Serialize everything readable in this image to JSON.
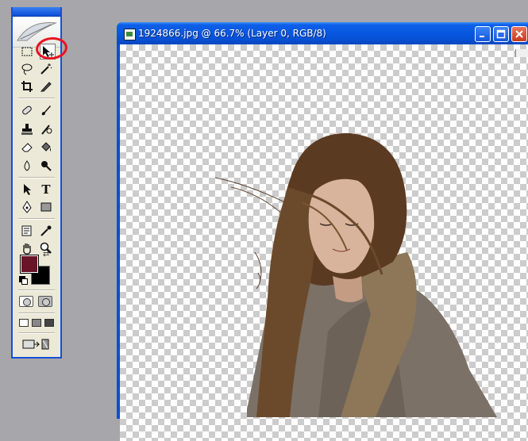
{
  "document": {
    "title": "1924866.jpg @ 66.7% (Layer 0, RGB/8)",
    "buttons": {
      "minimize": "_",
      "maximize": "□",
      "close": "✕"
    }
  },
  "toolbox": {
    "foreground_color": "#6a1428",
    "background_color": "#000000",
    "highlighted_tool": "move-tool",
    "highlight_color": "#e8141f",
    "type_tool_glyph": "T",
    "swap_glyph": "⇄"
  },
  "colors": {
    "desktop": "#a7a6aa",
    "xp_blue": "#0a4fd6",
    "checker": "#cccccc"
  }
}
